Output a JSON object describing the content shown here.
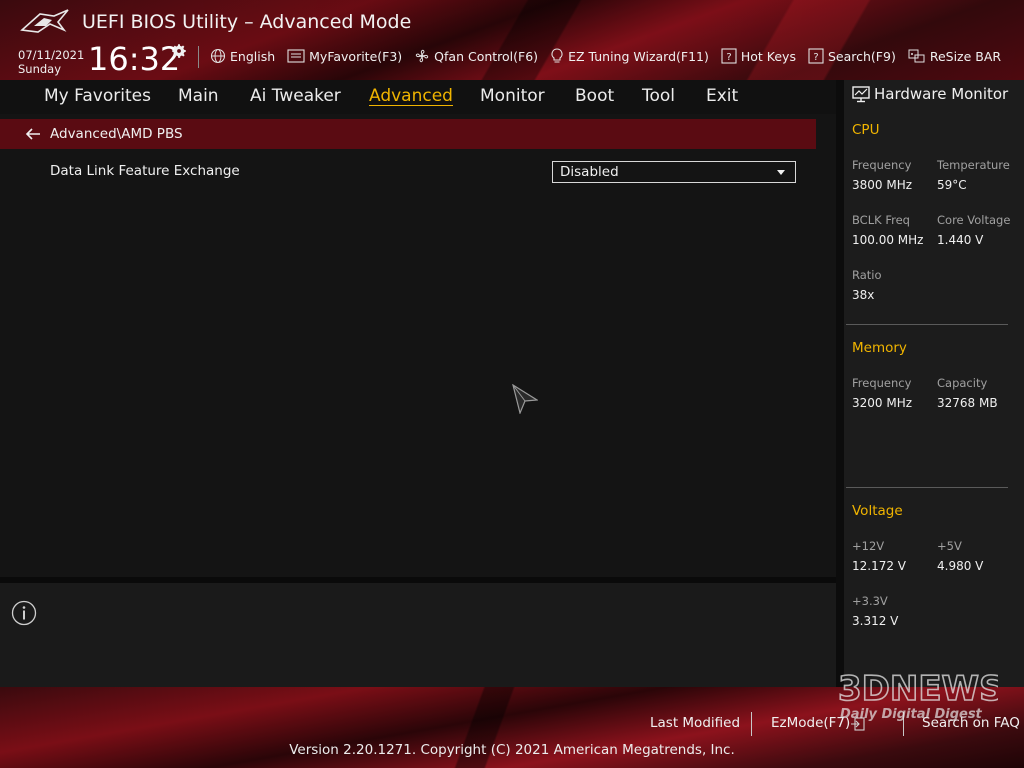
{
  "header": {
    "title": "UEFI BIOS Utility – Advanced Mode",
    "date": "07/11/2021",
    "weekday": "Sunday",
    "time": "16:32",
    "toolbar": [
      {
        "label": "English",
        "icon": "globe-icon"
      },
      {
        "label": "MyFavorite(F3)",
        "icon": "favorite-icon"
      },
      {
        "label": "Qfan Control(F6)",
        "icon": "fan-icon"
      },
      {
        "label": "EZ Tuning Wizard(F11)",
        "icon": "bulb-icon"
      },
      {
        "label": "Hot Keys",
        "icon": "question-icon"
      },
      {
        "label": "Search(F9)",
        "icon": "question-icon"
      },
      {
        "label": "ReSize BAR",
        "icon": "resize-bar-icon"
      }
    ]
  },
  "nav": {
    "items": [
      "My Favorites",
      "Main",
      "Ai Tweaker",
      "Advanced",
      "Monitor",
      "Boot",
      "Tool",
      "Exit"
    ],
    "active": "Advanced"
  },
  "breadcrumb": "Advanced\\AMD PBS",
  "settings": [
    {
      "label": "Data Link Feature Exchange",
      "value": "Disabled"
    }
  ],
  "hw_monitor": {
    "title": "Hardware Monitor",
    "cpu": {
      "heading": "CPU",
      "frequency_label": "Frequency",
      "frequency": "3800 MHz",
      "temperature_label": "Temperature",
      "temperature": "59°C",
      "bclk_label": "BCLK Freq",
      "bclk": "100.00 MHz",
      "core_voltage_label": "Core Voltage",
      "core_voltage": "1.440 V",
      "ratio_label": "Ratio",
      "ratio": "38x"
    },
    "memory": {
      "heading": "Memory",
      "frequency_label": "Frequency",
      "frequency": "3200 MHz",
      "capacity_label": "Capacity",
      "capacity": "32768 MB"
    },
    "voltage": {
      "heading": "Voltage",
      "v12_label": "+12V",
      "v12": "12.172 V",
      "v5_label": "+5V",
      "v5": "4.980 V",
      "v33_label": "+3.3V",
      "v33": "3.312 V"
    }
  },
  "footer": {
    "last_modified": "Last Modified",
    "ezmode": "EzMode(F7)",
    "search_faq": "Search on FAQ",
    "copyright": "Version 2.20.1271. Copyright (C) 2021 American Megatrends, Inc."
  },
  "watermark": {
    "brand": "3DNEWS",
    "tagline": "Daily Digital Digest"
  },
  "colors": {
    "accent": "#f0b400",
    "breadcrumb_bg": "#5a0b12",
    "panel_bg": "#141414"
  }
}
